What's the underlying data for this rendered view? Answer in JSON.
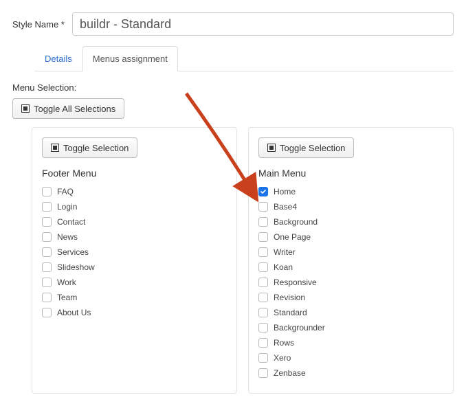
{
  "form": {
    "styleNameLabel": "Style Name *",
    "styleNameValue": "buildr - Standard"
  },
  "tabs": {
    "details": "Details",
    "menus": "Menus assignment"
  },
  "section": {
    "menuSelectionLabel": "Menu Selection:",
    "toggleAll": "Toggle All Selections",
    "toggleSelection": "Toggle Selection"
  },
  "panels": {
    "footer": {
      "title": "Footer Menu",
      "items": [
        {
          "label": "FAQ",
          "checked": false
        },
        {
          "label": "Login",
          "checked": false
        },
        {
          "label": "Contact",
          "checked": false
        },
        {
          "label": "News",
          "checked": false
        },
        {
          "label": "Services",
          "checked": false
        },
        {
          "label": "Slideshow",
          "checked": false
        },
        {
          "label": "Work",
          "checked": false
        },
        {
          "label": "Team",
          "checked": false
        },
        {
          "label": "About Us",
          "checked": false
        }
      ]
    },
    "main": {
      "title": "Main Menu",
      "items": [
        {
          "label": "Home",
          "checked": true
        },
        {
          "label": "Base4",
          "checked": false
        },
        {
          "label": "Background",
          "checked": false
        },
        {
          "label": "One Page",
          "checked": false
        },
        {
          "label": "Writer",
          "checked": false
        },
        {
          "label": "Koan",
          "checked": false
        },
        {
          "label": "Responsive",
          "checked": false
        },
        {
          "label": "Revision",
          "checked": false
        },
        {
          "label": "Standard",
          "checked": false
        },
        {
          "label": "Backgrounder",
          "checked": false
        },
        {
          "label": "Rows",
          "checked": false
        },
        {
          "label": "Xero",
          "checked": false
        },
        {
          "label": "Zenbase",
          "checked": false
        }
      ]
    }
  },
  "arrow": {
    "color": "#c9401c"
  }
}
